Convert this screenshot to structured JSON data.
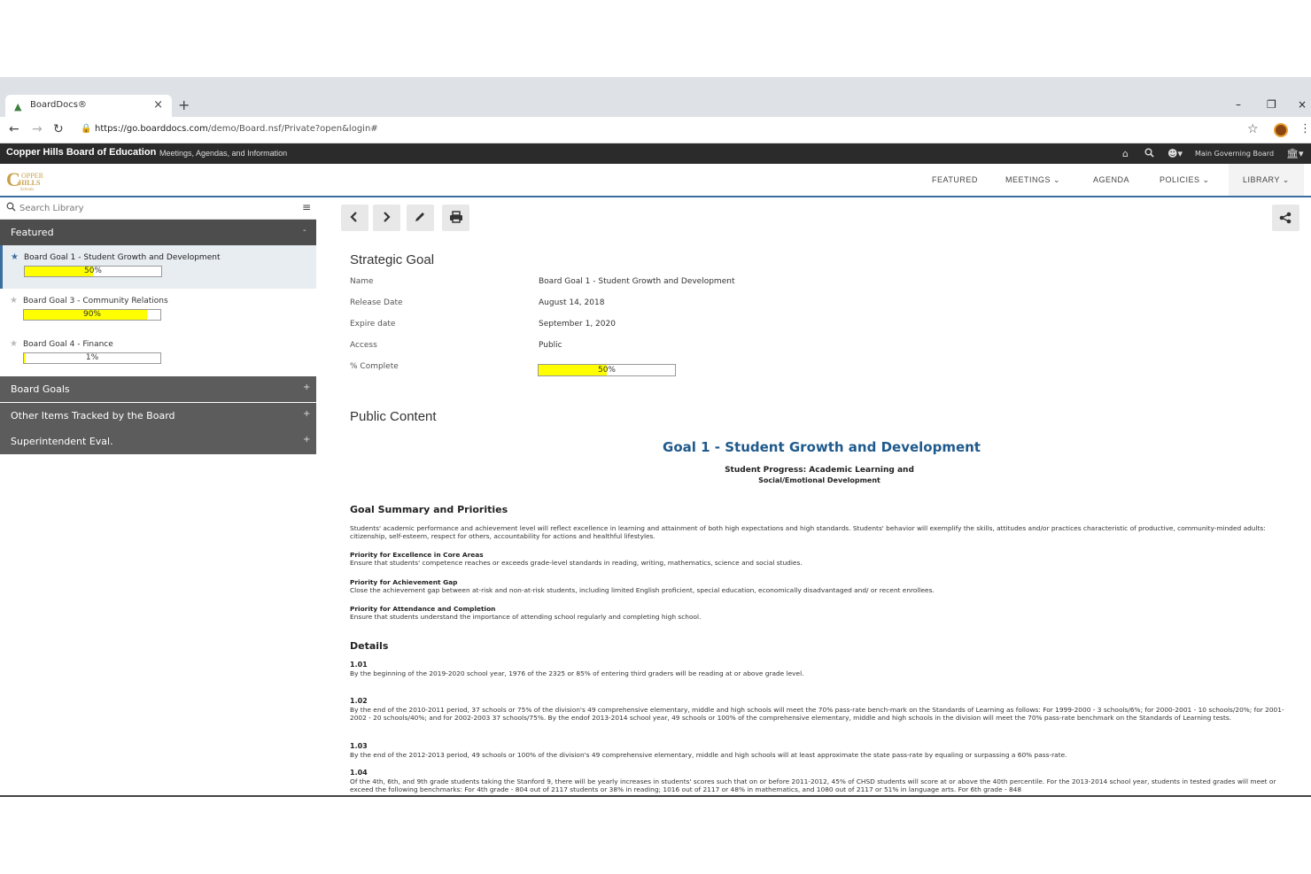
{
  "browser": {
    "tab_title": "BoardDocs®",
    "url_host": "https://go.boarddocs.com",
    "url_path": "/demo/Board.nsf/Private?open&login#"
  },
  "topbar": {
    "org_name": "Copper Hills Board of Education",
    "tagline": "Meetings, Agendas, and Information",
    "governing_board": "Main Governing Board"
  },
  "logo": {
    "c": "C",
    "opper": "OPPER",
    "hills": "HILLS",
    "schools": "Schools"
  },
  "nav": {
    "featured": "FEATURED",
    "meetings": "MEETINGS",
    "agenda": "AGENDA",
    "policies": "POLICIES",
    "library": "LIBRARY"
  },
  "sidebar": {
    "search_placeholder": "Search Library",
    "featured_label": "Featured",
    "goals": [
      {
        "name": "Board Goal 1 - Student Growth and Development",
        "percent": 50,
        "percent_label": "50%"
      },
      {
        "name": "Board Goal 3 - Community Relations",
        "percent": 90,
        "percent_label": "90%"
      },
      {
        "name": "Board Goal 4 - Finance",
        "percent": 1,
        "percent_label": "1%"
      }
    ],
    "sections": [
      {
        "label": "Board Goals"
      },
      {
        "label": "Other Items Tracked by the Board"
      },
      {
        "label": "Superintendent Eval."
      }
    ]
  },
  "strategic_goal": {
    "heading": "Strategic Goal",
    "fields": [
      {
        "label": "Name",
        "value": "Board Goal 1 - Student Growth and Development"
      },
      {
        "label": "Release Date",
        "value": "August 14, 2018"
      },
      {
        "label": "Expire date",
        "value": "September 1, 2020"
      },
      {
        "label": "Access",
        "value": "Public"
      },
      {
        "label": "% Complete",
        "value": "50%"
      }
    ],
    "complete_percent": 50
  },
  "public_content": {
    "heading": "Public Content",
    "doc_title": "Goal 1 - Student Growth and Development",
    "doc_subtitle": "Student Progress: Academic Learning and",
    "doc_subtitle2": "Social/Emotional Development",
    "summary_heading": "Goal Summary and Priorities",
    "summary_text": "Students' academic performance and achievement level will reflect excellence in learning and attainment of both high expectations and high standards. Students' behavior will exemplify the skills, attitudes and/or practices characteristic of productive, community-minded adults: citizenship, self-esteem, respect for others, accountability for actions and healthful lifestyles.",
    "priorities": [
      {
        "title": "Priority for Excellence in Core Areas",
        "text": "Ensure that students' competence reaches or exceeds grade-level standards in reading, writing, mathematics, science and social studies."
      },
      {
        "title": "Priority for Achievement Gap",
        "text": "Close the achievement gap between at-risk and non-at-risk students, including limited English proficient, special education, economically disadvantaged and/ or recent enrollees."
      },
      {
        "title": "Priority for Attendance and Completion",
        "text": "Ensure that students understand the importance of attending school regularly and completing high school."
      }
    ],
    "details_heading": "Details",
    "details": [
      {
        "num": "1.01",
        "text": "By the beginning of the 2019-2020 school year, 1976 of the 2325 or 85% of entering third graders will be reading at or above grade level."
      },
      {
        "num": "1.02",
        "text": "By the end of the 2010-2011 period, 37 schools or 75% of the division's 49 comprehensive elementary, middle and high schools will meet the 70% pass-rate bench-mark on the Standards of Learning as follows: For 1999-2000 - 3 schools/6%; for 2000-2001 - 10 schools/20%; for 2001-2002 - 20 schools/40%; and for 2002-2003 37 schools/75%. By the endof 2013-2014 school year, 49 schools or 100% of the comprehensive elementary, middle and high schools in the division will meet the 70% pass-rate benchmark on the Standards of Learning tests."
      },
      {
        "num": "1.03",
        "text": "By the end of the 2012-2013 period, 49 schools or 100% of the division's 49 comprehensive elementary, middle and high schools will at least approximate the state pass-rate by equaling or surpassing a 60% pass-rate."
      },
      {
        "num": "1.04",
        "text": "Of the 4th, 6th, and 9th grade students taking the Stanford 9, there will be yearly increases in students' scores such that on or before 2011-2012, 45% of CHSD students will score at or above the 40th percentile. For the 2013-2014 school year, students in tested grades will meet or exceed the following benchmarks: For 4th grade - 804 out of 2117 students or 38% in reading; 1016 out of 2117 or 48% in mathematics, and 1080 out of 2117 or 51% in language arts. For 6th grade - 848"
      }
    ]
  }
}
